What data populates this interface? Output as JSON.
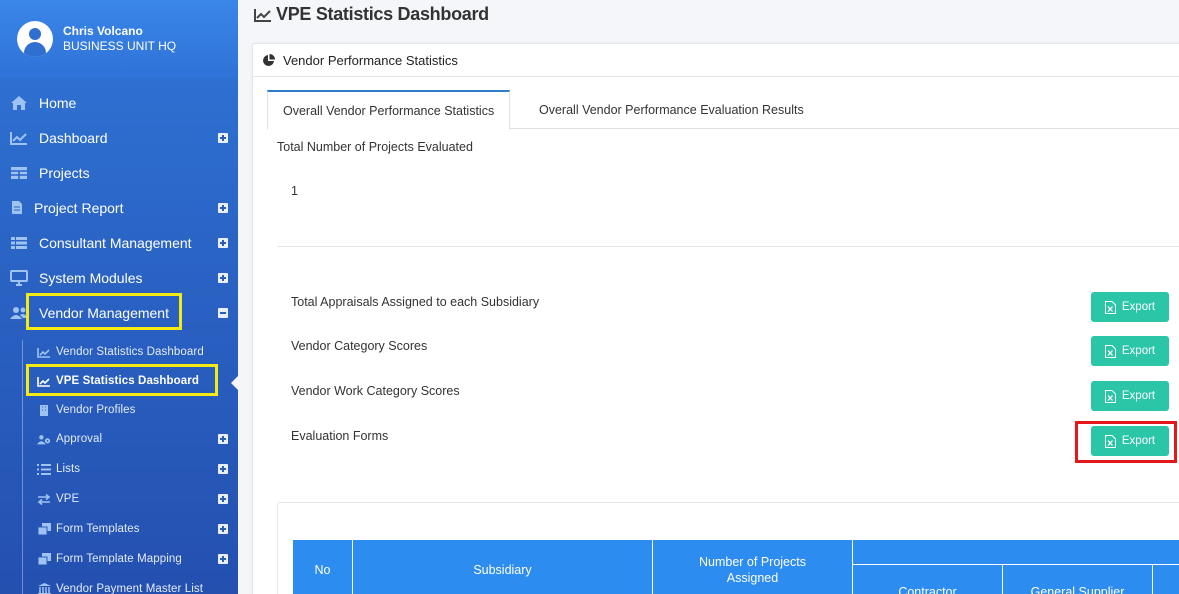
{
  "user": {
    "name": "Chris Volcano",
    "unit": "BUSINESS UNIT HQ"
  },
  "nav": {
    "items": [
      {
        "label": "Home",
        "icon": "home-icon"
      },
      {
        "label": "Dashboard",
        "icon": "chart-line-icon"
      },
      {
        "label": "Projects",
        "icon": "table-icon"
      },
      {
        "label": "Project Report",
        "icon": "file-icon"
      },
      {
        "label": "Consultant Management",
        "icon": "list-icon"
      },
      {
        "label": "System Modules",
        "icon": "desktop-icon"
      },
      {
        "label": "Vendor Management",
        "icon": "users-icon"
      }
    ],
    "subitems": [
      {
        "label": "Vendor Statistics Dashboard",
        "icon": "chart-line-icon"
      },
      {
        "label": "VPE Statistics Dashboard",
        "icon": "chart-line-icon"
      },
      {
        "label": "Vendor Profiles",
        "icon": "building-icon"
      },
      {
        "label": "Approval",
        "icon": "users-cog-icon"
      },
      {
        "label": "Lists",
        "icon": "list-icon"
      },
      {
        "label": "VPE",
        "icon": "exchange-icon"
      },
      {
        "label": "Form Templates",
        "icon": "clone-icon"
      },
      {
        "label": "Form Template Mapping",
        "icon": "clone-icon"
      },
      {
        "label": "Vendor Payment Master List",
        "icon": "bank-icon"
      }
    ]
  },
  "page": {
    "title": "VPE Statistics Dashboard"
  },
  "card": {
    "title": "Vendor Performance Statistics",
    "tabs": [
      {
        "label": "Overall Vendor Performance Statistics",
        "active": true
      },
      {
        "label": "Overall Vendor Performance Evaluation Results",
        "active": false
      }
    ],
    "total_label": "Total Number of Projects Evaluated",
    "total_value": "1",
    "reports": [
      {
        "label": "Total Appraisals Assigned to each Subsidiary",
        "button": "Export"
      },
      {
        "label": "Vendor Category Scores",
        "button": "Export"
      },
      {
        "label": "Vendor Work Category Scores",
        "button": "Export"
      },
      {
        "label": "Evaluation Forms",
        "button": "Export"
      }
    ],
    "table": {
      "headers": [
        "No",
        "Subsidiary",
        "Number of Projects Assigned",
        "",
        "Contractor",
        "General Supplier"
      ]
    }
  },
  "colors": {
    "sidebar": "#2a63c4",
    "highlight": "#f5ea12",
    "export": "#2bc6a8",
    "red_box": "#e4181c",
    "table_header": "#2d8cf0"
  }
}
